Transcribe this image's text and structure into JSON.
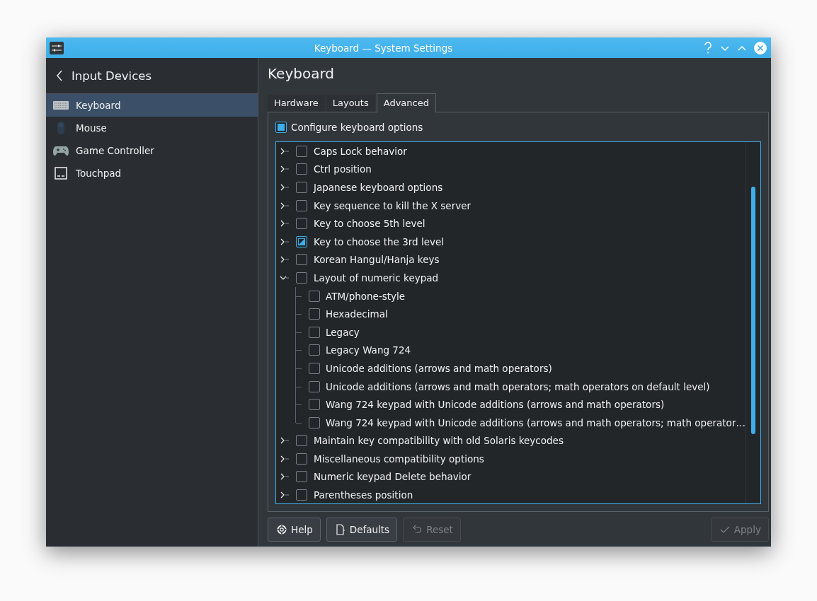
{
  "window": {
    "title": "Keyboard — System Settings"
  },
  "sidebar": {
    "back_title": "Input Devices",
    "items": [
      {
        "label": "Keyboard",
        "selected": true
      },
      {
        "label": "Mouse",
        "selected": false
      },
      {
        "label": "Game Controller",
        "selected": false
      },
      {
        "label": "Touchpad",
        "selected": false
      }
    ]
  },
  "page": {
    "title": "Keyboard"
  },
  "tabs": [
    {
      "label": "Hardware",
      "selected": false
    },
    {
      "label": "Layouts",
      "selected": false
    },
    {
      "label": "Advanced",
      "selected": true
    }
  ],
  "configure": {
    "label": "Configure keyboard options",
    "checked": true
  },
  "options": [
    {
      "label": "Caps Lock behavior",
      "checked": false,
      "partial": false,
      "expanded": false
    },
    {
      "label": "Ctrl position",
      "checked": false,
      "partial": false,
      "expanded": false
    },
    {
      "label": "Japanese keyboard options",
      "checked": false,
      "partial": false,
      "expanded": false
    },
    {
      "label": "Key sequence to kill the X server",
      "checked": false,
      "partial": false,
      "expanded": false
    },
    {
      "label": "Key to choose 5th level",
      "checked": false,
      "partial": false,
      "expanded": false
    },
    {
      "label": "Key to choose the 3rd level",
      "checked": false,
      "partial": true,
      "expanded": false
    },
    {
      "label": "Korean Hangul/Hanja keys",
      "checked": false,
      "partial": false,
      "expanded": false
    },
    {
      "label": "Layout of numeric keypad",
      "checked": false,
      "partial": false,
      "expanded": true,
      "children": [
        {
          "label": "ATM/phone-style",
          "checked": false
        },
        {
          "label": "Hexadecimal",
          "checked": false
        },
        {
          "label": "Legacy",
          "checked": false
        },
        {
          "label": "Legacy Wang 724",
          "checked": false
        },
        {
          "label": "Unicode additions (arrows and math operators)",
          "checked": false
        },
        {
          "label": "Unicode additions (arrows and math operators; math operators on default level)",
          "checked": false
        },
        {
          "label": "Wang 724 keypad with Unicode additions (arrows and math operators)",
          "checked": false
        },
        {
          "label": "Wang 724 keypad with Unicode additions (arrows and math operators; math operator…",
          "checked": false
        }
      ]
    },
    {
      "label": "Maintain key compatibility with old Solaris keycodes",
      "checked": false,
      "partial": false,
      "expanded": false
    },
    {
      "label": "Miscellaneous compatibility options",
      "checked": false,
      "partial": false,
      "expanded": false
    },
    {
      "label": "Numeric keypad Delete behavior",
      "checked": false,
      "partial": false,
      "expanded": false
    },
    {
      "label": "Parentheses position",
      "checked": false,
      "partial": false,
      "expanded": false
    }
  ],
  "buttons": [
    {
      "label": "Help",
      "disabled": false
    },
    {
      "label": "Defaults",
      "disabled": false
    },
    {
      "label": "Reset",
      "disabled": true
    },
    {
      "label": "Apply",
      "disabled": true
    }
  ]
}
